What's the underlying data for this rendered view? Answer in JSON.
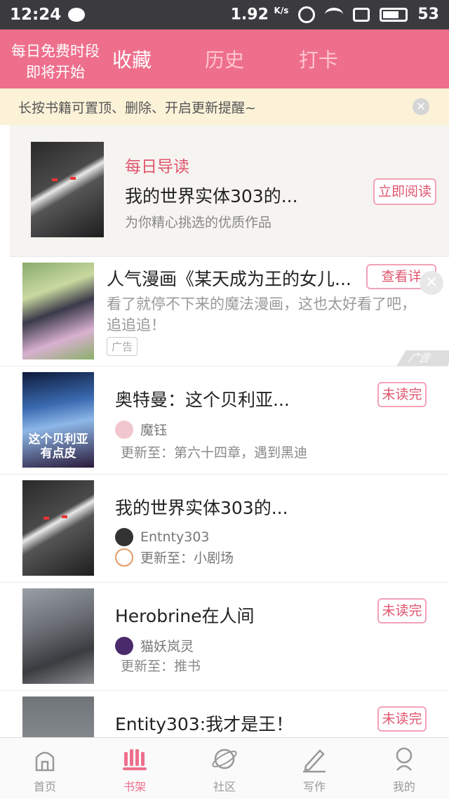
{
  "status_bar": {
    "time": "12:24",
    "speed": "1.92",
    "speed_unit": "K/s",
    "battery": "53"
  },
  "header": {
    "free_line1": "每日免费时段",
    "free_line2": "即将开始",
    "tabs": [
      {
        "label": "收藏",
        "active": true
      },
      {
        "label": "历史",
        "active": false
      },
      {
        "label": "打卡",
        "active": false
      }
    ]
  },
  "notice": {
    "text": "长按书籍可置顶、删除、开启更新提醒~"
  },
  "daily": {
    "label": "每日导读",
    "title": "我的世界实体303的...",
    "subtitle": "为你精心挑选的优质作品",
    "button": "立即阅读"
  },
  "ad": {
    "title": "人气漫画《某天成为王的女儿...",
    "button": "查看详",
    "desc": "看了就停不下来的魔法漫画，这也太好看了吧，追追追！",
    "badge": "广告",
    "corner": "广告"
  },
  "books": [
    {
      "title": "奥特曼：这个贝利亚...",
      "author": "魔钰",
      "update": "更新至：第六十四章，遇到黑迪",
      "status": "未读完",
      "cover_text": "这个贝利亚有点皮"
    },
    {
      "title": "我的世界实体303的...",
      "author": "Entnty303",
      "update": "更新至：小剧场",
      "status": ""
    },
    {
      "title": "Herobrine在人间",
      "author": "猫妖岚灵",
      "update": "更新至：推书",
      "status": "未读完"
    },
    {
      "title": "Entity303:我才是王！",
      "author": "",
      "update": "",
      "status": "未读完"
    }
  ],
  "bottom_nav": [
    {
      "label": "首页",
      "icon": "home-icon",
      "active": false
    },
    {
      "label": "书架",
      "icon": "bookshelf-icon",
      "active": true
    },
    {
      "label": "社区",
      "icon": "planet-icon",
      "active": false
    },
    {
      "label": "写作",
      "icon": "pencil-icon",
      "active": false
    },
    {
      "label": "我的",
      "icon": "profile-icon",
      "active": false
    }
  ],
  "colors": {
    "accent": "#ee6f8c",
    "notice_bg": "#fbf2d8",
    "status_bar": "#3b3b3f"
  }
}
